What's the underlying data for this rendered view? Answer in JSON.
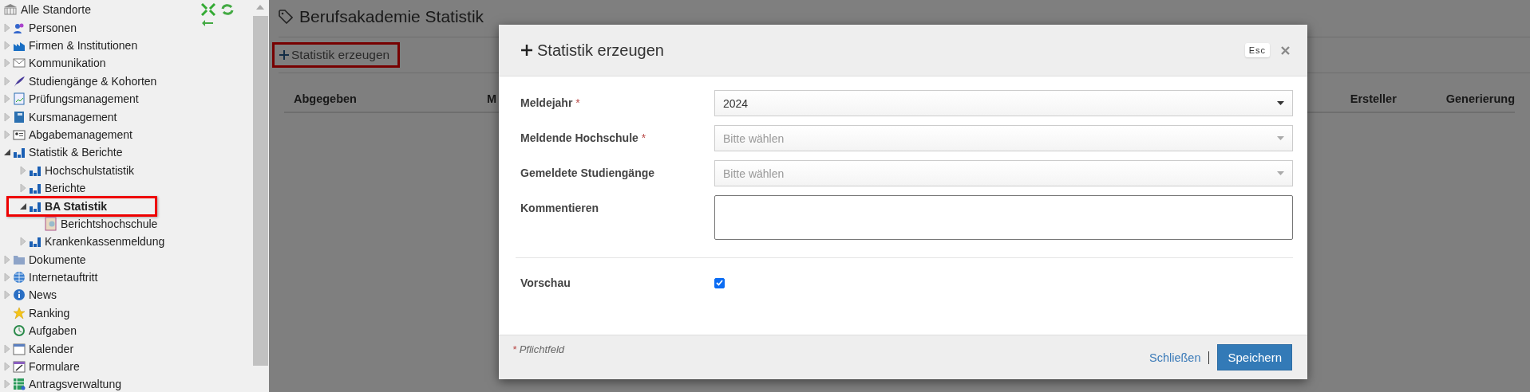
{
  "sidebar": {
    "root": {
      "label": "Alle Standorte"
    },
    "items": [
      {
        "label": "Personen",
        "kind": "branch",
        "expanded": false,
        "selected": false
      },
      {
        "label": "Firmen & Institutionen",
        "kind": "branch",
        "expanded": false,
        "selected": false
      },
      {
        "label": "Kommunikation",
        "kind": "branch",
        "expanded": false,
        "selected": false
      },
      {
        "label": "Studiengänge & Kohorten",
        "kind": "branch",
        "expanded": false,
        "selected": false
      },
      {
        "label": "Prüfungsmanagement",
        "kind": "branch",
        "expanded": false,
        "selected": false
      },
      {
        "label": "Kursmanagement",
        "kind": "branch",
        "expanded": false,
        "selected": false
      },
      {
        "label": "Abgabemanagement",
        "kind": "branch",
        "expanded": false,
        "selected": false
      },
      {
        "label": "Statistik & Berichte",
        "kind": "branch",
        "expanded": true,
        "selected": false,
        "children": [
          {
            "label": "Hochschulstatistik",
            "kind": "branch",
            "expanded": false,
            "selected": false
          },
          {
            "label": "Berichte",
            "kind": "branch",
            "expanded": false,
            "selected": false
          },
          {
            "label": "BA Statistik",
            "kind": "branch",
            "expanded": true,
            "selected": true,
            "highlighted": true,
            "children": [
              {
                "label": "Berichtshochschule",
                "kind": "leaf",
                "selected": false
              }
            ]
          },
          {
            "label": "Krankenkassenmeldung",
            "kind": "branch",
            "expanded": false,
            "selected": false
          }
        ]
      },
      {
        "label": "Dokumente",
        "kind": "branch",
        "expanded": false,
        "selected": false
      },
      {
        "label": "Internetauftritt",
        "kind": "branch",
        "expanded": false,
        "selected": false
      },
      {
        "label": "News",
        "kind": "branch",
        "expanded": false,
        "selected": false
      },
      {
        "label": "Ranking",
        "kind": "leaf",
        "selected": false
      },
      {
        "label": "Aufgaben",
        "kind": "leaf",
        "selected": false
      },
      {
        "label": "Kalender",
        "kind": "branch",
        "expanded": false,
        "selected": false
      },
      {
        "label": "Formulare",
        "kind": "branch",
        "expanded": false,
        "selected": false
      },
      {
        "label": "Antragsverwaltung",
        "kind": "branch",
        "expanded": false,
        "selected": false
      }
    ]
  },
  "page": {
    "title": "Berufsakademie Statistik",
    "toolbar": {
      "button": "Statistik erzeugen",
      "highlighted": true
    },
    "table": {
      "columns": [
        "Abgegeben",
        "M",
        "Ersteller",
        "Generierung"
      ]
    }
  },
  "dialog": {
    "title": "Statistik erzeugen",
    "esc": "Esc",
    "fields": [
      {
        "kind": "select",
        "label": "Meldejahr",
        "required_mark": "*",
        "value": "2024"
      },
      {
        "kind": "select",
        "label": "Meldende Hochschule",
        "required_mark": "*",
        "placeholder": "Bitte wählen"
      },
      {
        "kind": "select",
        "label": "Gemeldete Studiengänge",
        "placeholder": "Bitte wählen"
      },
      {
        "kind": "textarea",
        "label": "Kommentieren"
      },
      {
        "kind": "checkbox",
        "label": "Vorschau",
        "checked": true
      }
    ],
    "required_note_mark": "*",
    "required_note": "Pflichtfeld",
    "close": "Schließen",
    "save": "Speichern"
  }
}
